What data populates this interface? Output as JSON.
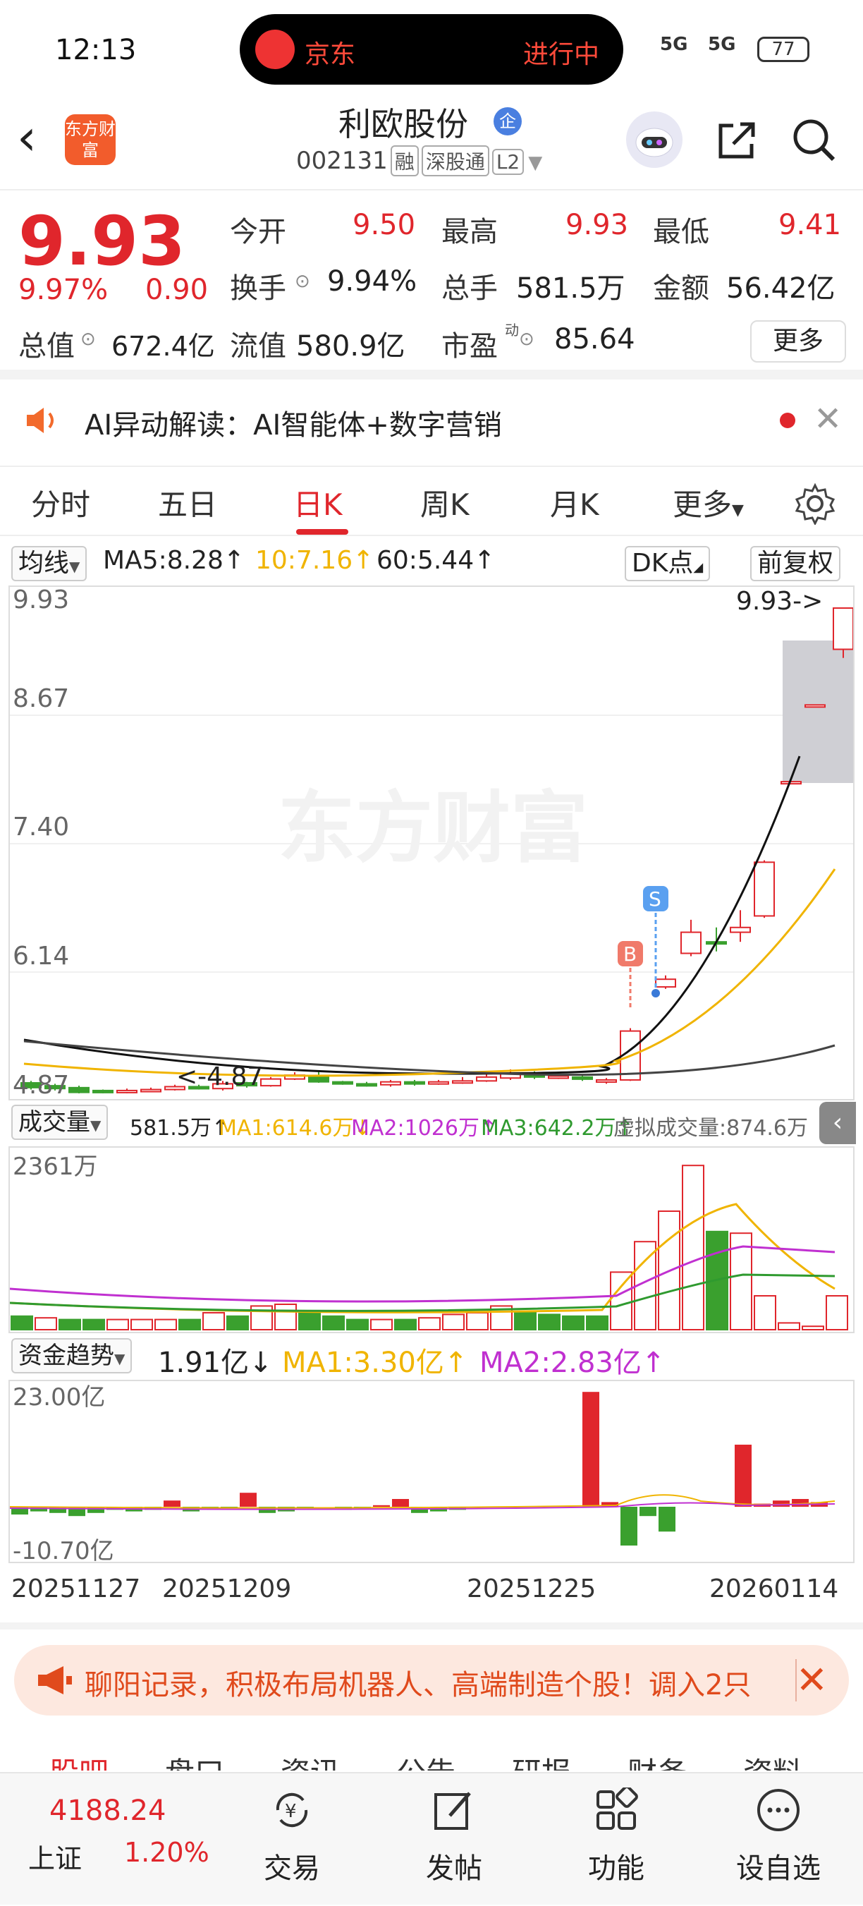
{
  "status_bar": {
    "time": "12:13",
    "live_app": "京东",
    "live_status": "进行中",
    "signal1": "5G",
    "signal2": "5G",
    "battery": "77"
  },
  "header": {
    "app_logo_text": "东方财富",
    "stock_name": "利欧股份",
    "stock_badge": "企",
    "stock_code": "002131",
    "tags": [
      "融",
      "深股通",
      "L2"
    ]
  },
  "quote": {
    "price": "9.93",
    "change_pct": "9.97%",
    "change": "0.90",
    "open_label": "今开",
    "open": "9.50",
    "high_label": "最高",
    "high": "9.93",
    "low_label": "最低",
    "low": "9.41",
    "turnover_label": "换手",
    "turnover": "9.94%",
    "volume_label": "总手",
    "volume": "581.5万",
    "amount_label": "金额",
    "amount": "56.42亿",
    "mktcap_label": "总值",
    "mktcap": "672.4亿",
    "float_label": "流值",
    "float": "580.9亿",
    "pe_label": "市盈",
    "pe_sup": "动",
    "pe": "85.64",
    "more_button": "更多"
  },
  "ai_bar": {
    "text": "AI异动解读：AI智能体+数字营销"
  },
  "tabs": [
    {
      "label": "分时"
    },
    {
      "label": "五日"
    },
    {
      "label": "日K"
    },
    {
      "label": "周K"
    },
    {
      "label": "月K"
    },
    {
      "label": "更多"
    }
  ],
  "ma": {
    "dropdown": "均线",
    "ma5": "MA5:8.28↑",
    "ma10": "10:7.16↑",
    "ma60": "60:5.44↑",
    "dk": "DK点",
    "adjust": "前复权"
  },
  "kchart": {
    "price_labels": [
      "9.93",
      "8.67",
      "7.40",
      "6.14",
      "4.87"
    ],
    "last_price_marker": "9.93->",
    "low_marker": "<-4.87",
    "watermark": "东方财富",
    "buy_marker": "B",
    "sell_marker": "S"
  },
  "volume": {
    "dropdown": "成交量",
    "current": "581.5万↑",
    "ma1": "MA1:614.6万↓",
    "ma2": "MA2:1026万↑",
    "ma3": "MA3:642.2万↑",
    "virtual": "虚拟成交量:874.6万",
    "max_label": "2361万"
  },
  "capital_flow": {
    "dropdown": "资金趋势",
    "current": "1.91亿↓",
    "ma1": "MA1:3.30亿↑",
    "ma2": "MA2:2.83亿↑",
    "max_label": "23.00亿",
    "min_label": "-10.70亿"
  },
  "dates": [
    "20251127",
    "20251209",
    "20251225",
    "20260114"
  ],
  "banner": {
    "text": "聊阳记录，积极布局机器人、高端制造个股！调入2只"
  },
  "subtabs": [
    "股吧",
    "盘口",
    "资讯",
    "公告",
    "研报",
    "财务",
    "资料"
  ],
  "bottom": {
    "index_value": "4188.24",
    "index_name": "上证",
    "index_pct": "1.20%",
    "nav": [
      {
        "label": "交易"
      },
      {
        "label": "发帖"
      },
      {
        "label": "功能"
      },
      {
        "label": "设自选"
      }
    ]
  },
  "colors": {
    "up": "#e0262c",
    "down": "#3aa02e",
    "ma1": "#f0b400",
    "ma2": "#c030d0",
    "ma3": "#2f9a2f"
  }
}
